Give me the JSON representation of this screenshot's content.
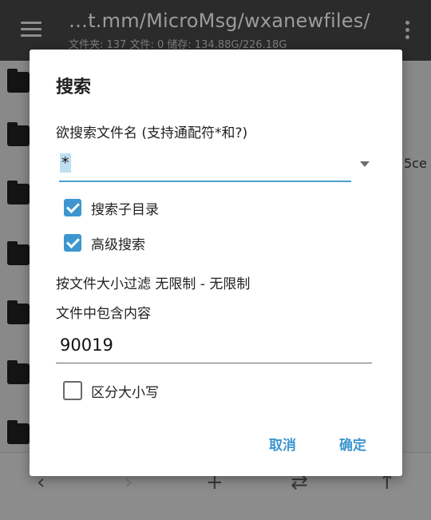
{
  "appbar": {
    "path": "…t.mm/MicroMsg/wxanewfiles/",
    "stats": "文件夹: 137   文件: 0   储存: 134.88G/226.18G"
  },
  "background": {
    "side_fragment": "5ce"
  },
  "dialog": {
    "title": "搜索",
    "filename_label": "欲搜索文件名 (支持通配符*和?)",
    "filename_value": "*",
    "search_subdirs": {
      "label": "搜索子目录",
      "checked": true
    },
    "advanced_search": {
      "label": "高级搜索",
      "checked": true
    },
    "size_filter": "按文件大小过滤  无限制 - 无限制",
    "content_label": "文件中包含内容",
    "content_value": "90019",
    "case_sensitive": {
      "label": "区分大小写",
      "checked": false
    },
    "cancel_label": "取消",
    "ok_label": "确定"
  },
  "bottombar": {
    "icons": [
      "back-icon",
      "forward-icon",
      "add-icon",
      "swap-icon",
      "up-icon"
    ]
  },
  "colors": {
    "accent": "#3d96cf",
    "appbar": "#2b2b2b",
    "scrim": "#898989"
  }
}
